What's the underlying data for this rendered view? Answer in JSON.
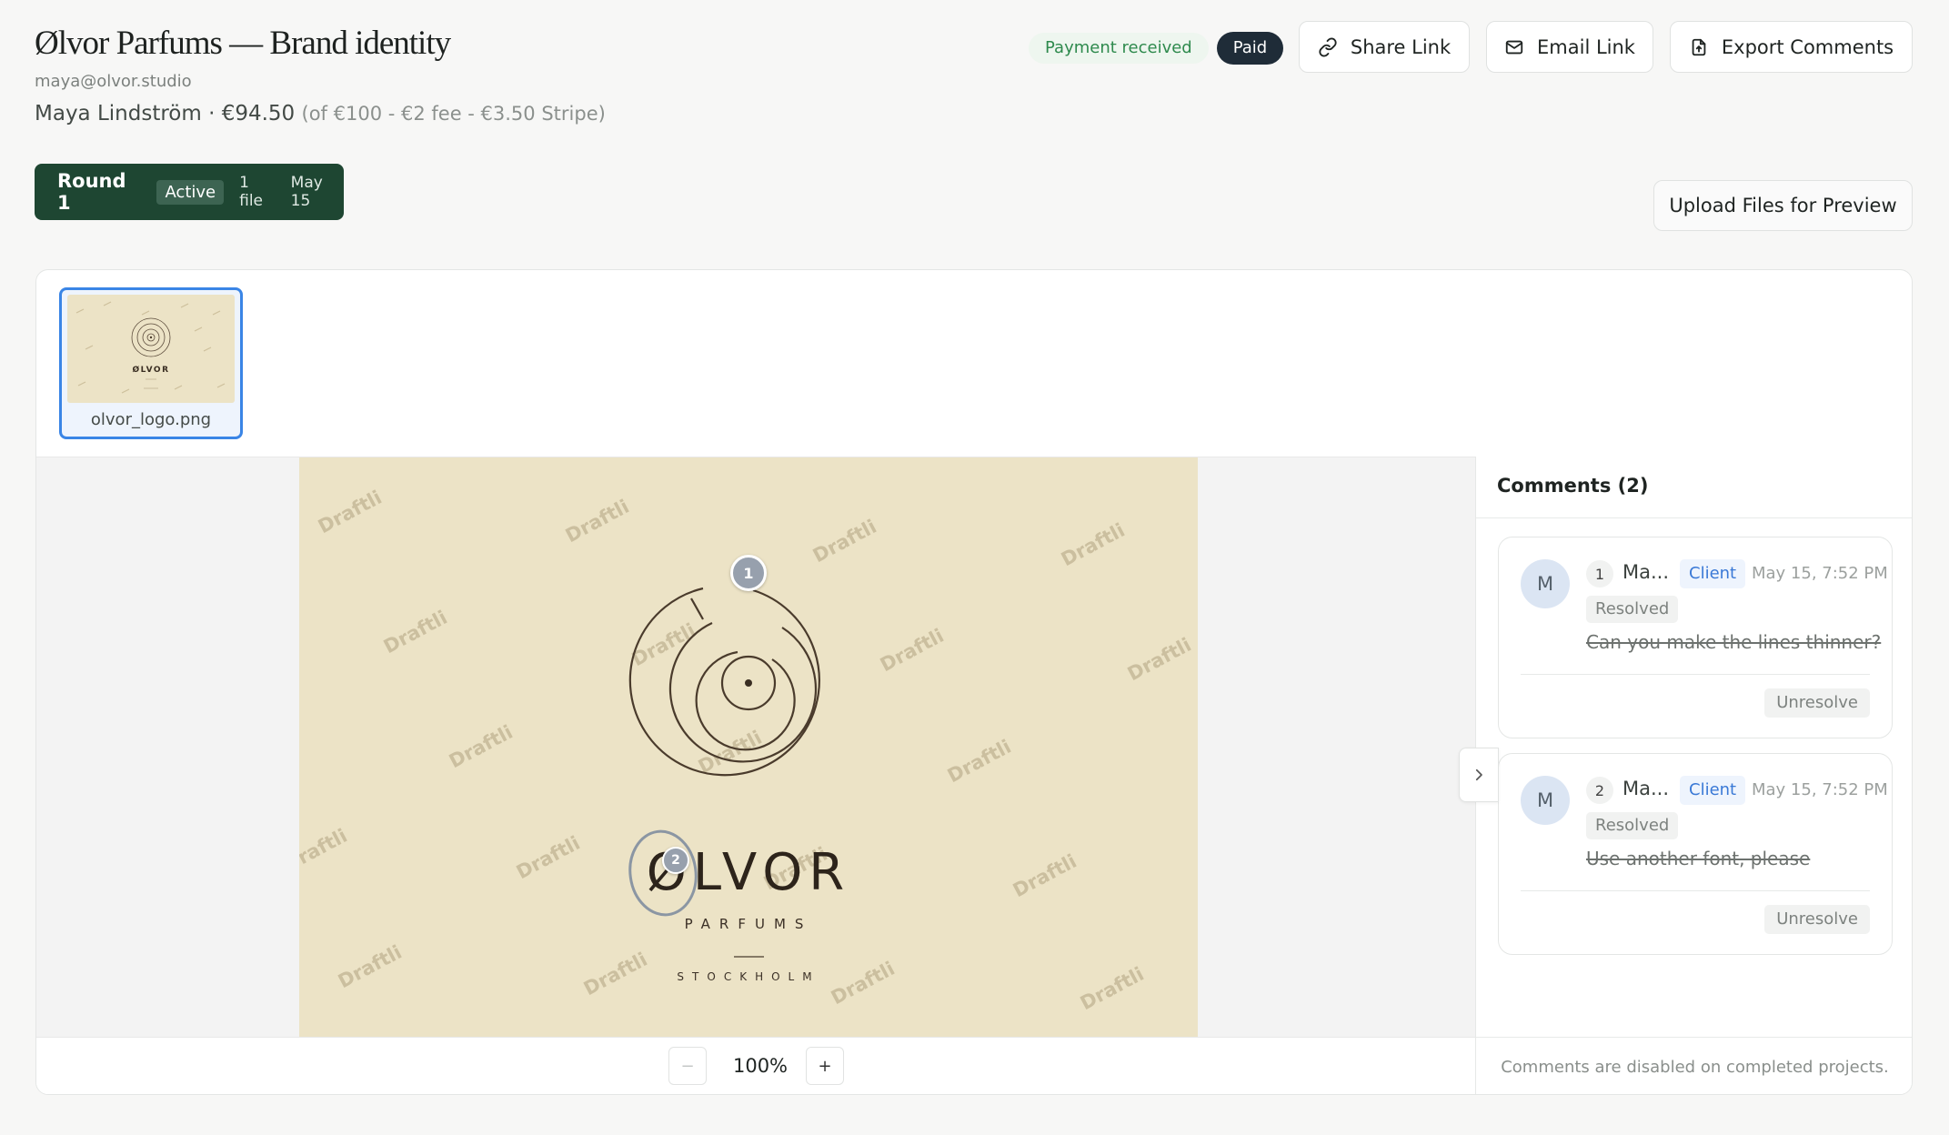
{
  "project": {
    "title": "Ølvor Parfums — Brand identity",
    "email": "maya@olvor.studio",
    "client_name_amount": "Maya Lindström · €94.50",
    "fee_breakdown": "(of €100 - €2 fee - €3.50 Stripe)"
  },
  "header": {
    "payment_status": "Payment received",
    "paid_badge": "Paid",
    "share_label": "Share Link",
    "email_label": "Email Link",
    "export_label": "Export Comments"
  },
  "round": {
    "name": "Round 1",
    "status": "Active",
    "file_count": "1 file",
    "date": "May 15"
  },
  "upload_label": "Upload Files for Preview",
  "file": {
    "name": "olvor_logo.png"
  },
  "artwork": {
    "brand": "ØLVOR",
    "subline": "PARFUMS",
    "city": "STOCKHOLM",
    "watermark": "Draftli",
    "background_color": "#ece3c6",
    "ink_color": "#4a3b2c"
  },
  "pins": [
    {
      "number": "1"
    },
    {
      "number": "2"
    }
  ],
  "zoom": {
    "minus": "−",
    "value": "100%",
    "plus": "+"
  },
  "comments": {
    "header": "Comments (2)",
    "items": [
      {
        "avatar": "M",
        "number": "1",
        "author": "Ma...",
        "role": "Client",
        "date": "May 15, 7:52 PM",
        "status": "Resolved",
        "text": "Can you make the lines thinner?",
        "action": "Unresolve"
      },
      {
        "avatar": "M",
        "number": "2",
        "author": "Ma...",
        "role": "Client",
        "date": "May 15, 7:52 PM",
        "status": "Resolved",
        "text": "Use another font, please",
        "action": "Unresolve"
      }
    ],
    "footer": "Comments are disabled on completed projects."
  }
}
